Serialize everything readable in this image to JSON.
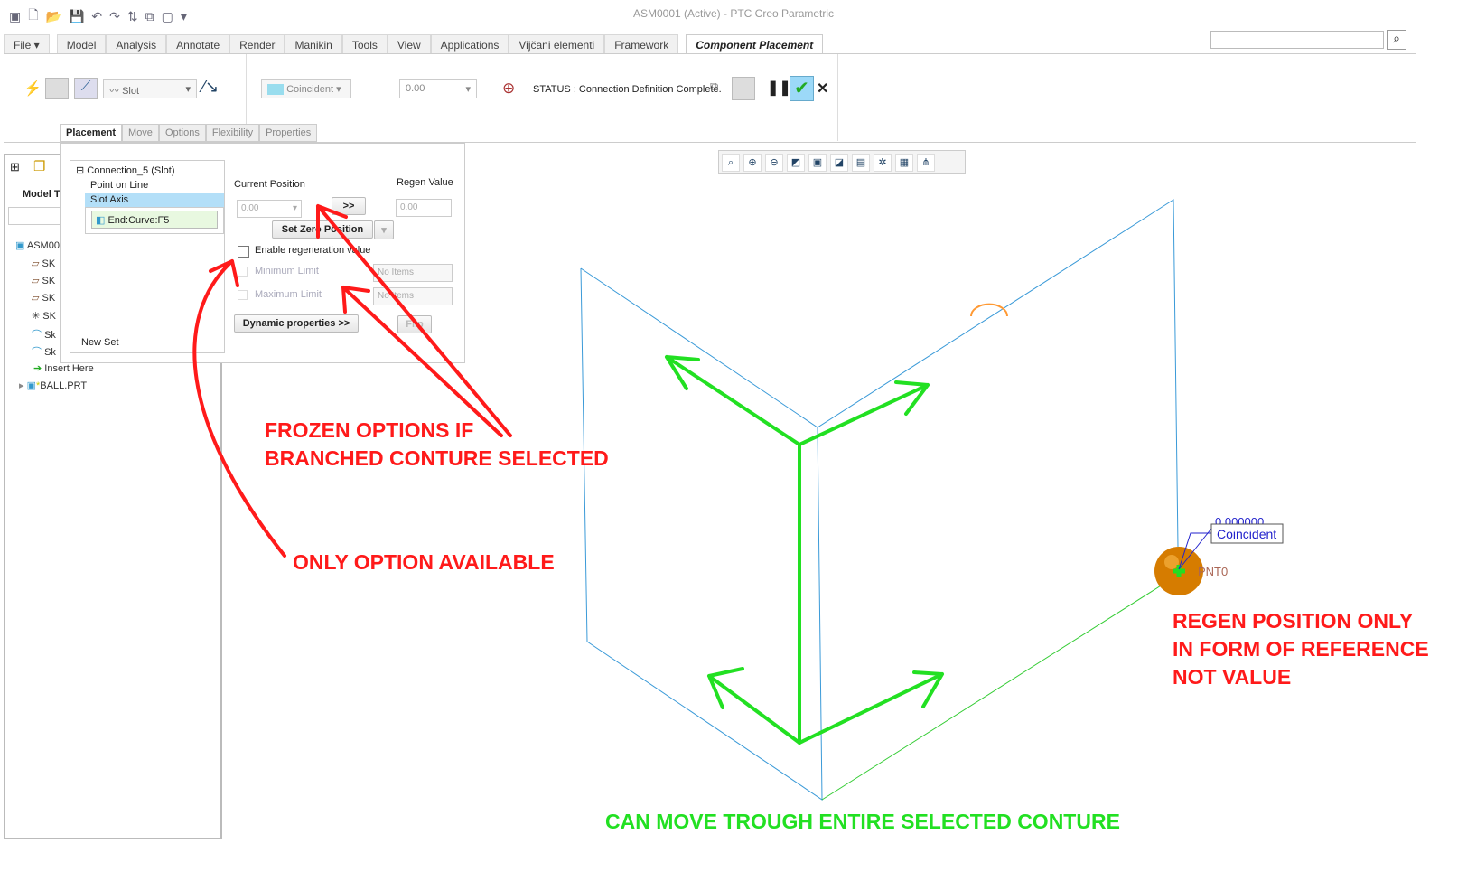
{
  "window": {
    "title": "ASM0001 (Active) - PTC Creo Parametric"
  },
  "menu_tabs": [
    "File ▾",
    "Model",
    "Analysis",
    "Annotate",
    "Render",
    "Manikin",
    "Tools",
    "View",
    "Applications",
    "Vijčani elementi",
    "Framework"
  ],
  "active_tab": "Component Placement",
  "ribbon": {
    "connection_type": "Slot",
    "constraint_type": "Coincident",
    "offset_value": "0.00",
    "status": "STATUS : Connection Definition Complete."
  },
  "subtabs": [
    "Placement",
    "Move",
    "Options",
    "Flexibility",
    "Properties"
  ],
  "placement": {
    "connection": "Connection_5 (Slot)",
    "items": [
      "Point on Line",
      "Slot Axis"
    ],
    "reference": "End:Curve:F5",
    "new_set": "New Set",
    "current_position_label": "Current Position",
    "current_position": "0.00",
    "go_button": ">>",
    "regen_value_label": "Regen Value",
    "regen_value": "0.00",
    "set_zero": "Set Zero Position",
    "enable_regen": "Enable regeneration value",
    "min_limit": "Minimum Limit",
    "max_limit": "Maximum Limit",
    "no_items": "No Items",
    "dynamic": "Dynamic properties >>",
    "flip": "Flip"
  },
  "model_tree": {
    "label": "Model T",
    "items": [
      "ASM00",
      "SK",
      "SK",
      "SK",
      "SK",
      "Sk",
      "Sk",
      "Insert Here",
      "BALL.PRT"
    ]
  },
  "viewport": {
    "dim_value": "0.000000",
    "constraint_label": "Coincident",
    "point_label": "PNT0"
  },
  "annotations": {
    "frozen": [
      "FROZEN OPTIONS IF",
      "BRANCHED CONTURE SELECTED"
    ],
    "only": "ONLY OPTION AVAILABLE",
    "regen": [
      "REGEN POSITION ONLY",
      "IN FORM OF REFERENCE",
      "NOT VALUE"
    ],
    "move": "CAN MOVE TROUGH ENTIRE SELECTED CONTURE"
  },
  "colors": {
    "annotation_red": "#ff1a1a",
    "annotation_green": "#22e022",
    "edge_blue": "#3a9ad8"
  }
}
